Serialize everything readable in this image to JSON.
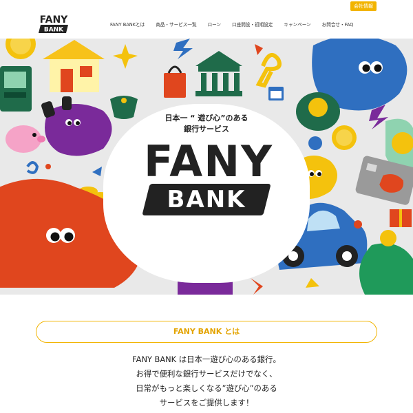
{
  "header": {
    "corp_badge": "会社情報",
    "logo_top": "FANY",
    "logo_bottom": "BANK",
    "nav": [
      "FANY BANKとは",
      "商品・サービス一覧",
      "ローン",
      "口座開設・初期設定",
      "キャンペーン",
      "お問合せ・FAQ"
    ]
  },
  "hero": {
    "tagline_1": "日本一 “ 遊び心”のある",
    "tagline_2": "銀行サービス",
    "title": "FANY",
    "subtitle": "BANK"
  },
  "about": {
    "heading": "FANY BANK とは",
    "lines": [
      "FANY BANK は日本一遊び心のある銀行。",
      "お得で便利な銀行サービスだけでなく、",
      "日常がもっと楽しくなる”遊び心”のある",
      "サービスをご提供します！"
    ]
  },
  "colors": {
    "accent": "#f2b400",
    "dark": "#222222",
    "orange": "#e0461e",
    "blue": "#2f6fc0",
    "purple": "#7a2a9a",
    "green": "#1f6b4a"
  }
}
